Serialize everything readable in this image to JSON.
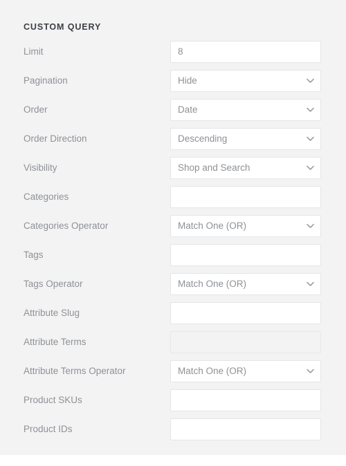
{
  "panel": {
    "title": "CUSTOM QUERY",
    "background_color": "#f3f3f4",
    "page_background_color": "#ffffff"
  },
  "colors": {
    "label": "#8e9195",
    "heading": "#3c3f43",
    "field_border": "#e4e5e7",
    "field_background": "#ffffff",
    "field_disabled_background": "#f3f3f4",
    "chevron": "#9b9ea2"
  },
  "icons": {
    "chevron_down": "chevron-down-icon"
  },
  "fields": [
    {
      "label": "Limit",
      "type": "text",
      "value": "8",
      "placeholder": "",
      "disabled": false,
      "name": "limit"
    },
    {
      "label": "Pagination",
      "type": "select",
      "value": "Hide",
      "placeholder": "",
      "disabled": false,
      "name": "pagination"
    },
    {
      "label": "Order",
      "type": "select",
      "value": "Date",
      "placeholder": "",
      "disabled": false,
      "name": "order"
    },
    {
      "label": "Order Direction",
      "type": "select",
      "value": "Descending",
      "placeholder": "",
      "disabled": false,
      "name": "order-direction"
    },
    {
      "label": "Visibility",
      "type": "select",
      "value": "Shop and Search",
      "placeholder": "",
      "disabled": false,
      "name": "visibility"
    },
    {
      "label": "Categories",
      "type": "text",
      "value": "",
      "placeholder": "",
      "disabled": false,
      "name": "categories"
    },
    {
      "label": "Categories Operator",
      "type": "select",
      "value": "Match One (OR)",
      "placeholder": "",
      "disabled": false,
      "name": "categories-operator"
    },
    {
      "label": "Tags",
      "type": "text",
      "value": "",
      "placeholder": "",
      "disabled": false,
      "name": "tags"
    },
    {
      "label": "Tags Operator",
      "type": "select",
      "value": "Match One (OR)",
      "placeholder": "",
      "disabled": false,
      "name": "tags-operator"
    },
    {
      "label": "Attribute Slug",
      "type": "text",
      "value": "",
      "placeholder": "",
      "disabled": false,
      "name": "attribute-slug"
    },
    {
      "label": "Attribute Terms",
      "type": "text",
      "value": "",
      "placeholder": "",
      "disabled": true,
      "name": "attribute-terms"
    },
    {
      "label": "Attribute Terms Operator",
      "type": "select",
      "value": "Match One (OR)",
      "placeholder": "",
      "disabled": false,
      "name": "attribute-terms-operator"
    },
    {
      "label": "Product SKUs",
      "type": "text",
      "value": "",
      "placeholder": "",
      "disabled": false,
      "name": "product-skus"
    },
    {
      "label": "Product IDs",
      "type": "text",
      "value": "",
      "placeholder": "",
      "disabled": false,
      "name": "product-ids"
    }
  ]
}
